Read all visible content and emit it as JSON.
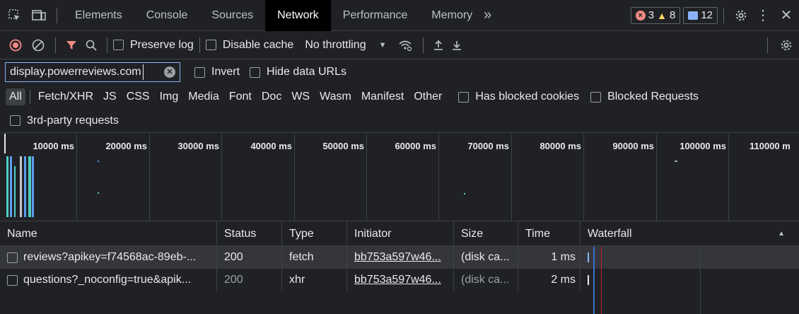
{
  "tabs": {
    "items": [
      "Elements",
      "Console",
      "Sources",
      "Network",
      "Performance",
      "Memory"
    ],
    "active": "Network",
    "more": "»"
  },
  "badges": {
    "errors": "3",
    "warnings": "8",
    "messages": "12"
  },
  "toolbar": {
    "preserve_log": "Preserve log",
    "disable_cache": "Disable cache",
    "throttling": "No throttling"
  },
  "filter": {
    "value": "display.powerreviews.com",
    "invert": "Invert",
    "hide_data_urls": "Hide data URLs"
  },
  "types": [
    "All",
    "Fetch/XHR",
    "JS",
    "CSS",
    "Img",
    "Media",
    "Font",
    "Doc",
    "WS",
    "Wasm",
    "Manifest",
    "Other"
  ],
  "has_blocked_cookies": "Has blocked cookies",
  "blocked_requests": "Blocked Requests",
  "third_party": "3rd-party requests",
  "overview": {
    "ticks": [
      "10000 ms",
      "20000 ms",
      "30000 ms",
      "40000 ms",
      "50000 ms",
      "60000 ms",
      "70000 ms",
      "80000 ms",
      "90000 ms",
      "100000 ms",
      "110000 m"
    ]
  },
  "table": {
    "headers": {
      "name": "Name",
      "status": "Status",
      "type": "Type",
      "initiator": "Initiator",
      "size": "Size",
      "time": "Time",
      "waterfall": "Waterfall"
    },
    "rows": [
      {
        "name": "reviews?apikey=f74568ac-89eb-...",
        "status": "200",
        "type": "fetch",
        "initiator": "bb753a597w46...",
        "size": "(disk ca...",
        "time": "1 ms"
      },
      {
        "name": "questions?_noconfig=true&apik...",
        "status": "200",
        "type": "xhr",
        "initiator": "bb753a597w46...",
        "size": "(disk ca...",
        "time": "2 ms"
      }
    ]
  },
  "colors": {
    "accent": "#8ab4f8",
    "record": "#f28b82",
    "filter": "#f28b82",
    "error": "#f28b82",
    "warning": "#fdd663"
  }
}
